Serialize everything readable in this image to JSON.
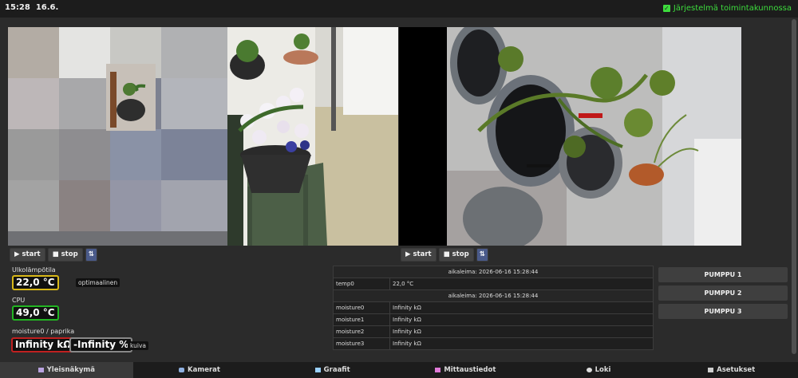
{
  "header": {
    "time": "15:28",
    "date": "16.6.",
    "status_text": "Järjestelmä toimintakunnossa"
  },
  "cameras": [
    {
      "start_label": "start",
      "stop_label": "stop",
      "extra_label": "⇅"
    },
    {
      "start_label": "start",
      "stop_label": "stop",
      "extra_label": "⇅"
    }
  ],
  "sensors": {
    "outdoor": {
      "label": "Ulkolämpötila",
      "value": "22,0 °C",
      "tag": "optimaalinen"
    },
    "cpu": {
      "label": "CPU",
      "value": "49,0 °C"
    },
    "moisture0": {
      "label": "moisture0 / paprika",
      "value": "Infinity kΩ",
      "value2": "-Infinity %",
      "tag": "kuiva"
    }
  },
  "table": {
    "rows": [
      {
        "type": "header",
        "text": "aikaleima: 2026-06-16 15:28:44"
      },
      {
        "type": "row",
        "key": "temp0",
        "value": "22,0 °C"
      },
      {
        "type": "header",
        "text": "aikaleima: 2026-06-16 15:28:44"
      },
      {
        "type": "row",
        "key": "moisture0",
        "value": "Infinity kΩ"
      },
      {
        "type": "row",
        "key": "moisture1",
        "value": "Infinity kΩ"
      },
      {
        "type": "row",
        "key": "moisture2",
        "value": "Infinity kΩ"
      },
      {
        "type": "row",
        "key": "moisture3",
        "value": "Infinity kΩ"
      }
    ]
  },
  "pumps": [
    "PUMPPU 1",
    "PUMPPU 2",
    "PUMPPU 3"
  ],
  "nav": [
    {
      "label": "Yleisnäkymä",
      "icon": "monitor-icon",
      "active": true
    },
    {
      "label": "Kamerat",
      "icon": "camera-icon",
      "active": false
    },
    {
      "label": "Graafit",
      "icon": "chart-icon",
      "active": false
    },
    {
      "label": "Mittaustiedot",
      "icon": "measure-icon",
      "active": false
    },
    {
      "label": "Loki",
      "icon": "log-icon",
      "active": false
    },
    {
      "label": "Asetukset",
      "icon": "settings-icon",
      "active": false
    }
  ],
  "colors": {
    "status_green": "#3ddc3d",
    "outdoor_border": "#d8b818",
    "cpu_border": "#23b523",
    "moisture_border": "#c02020",
    "moisture2_border": "#888888"
  }
}
